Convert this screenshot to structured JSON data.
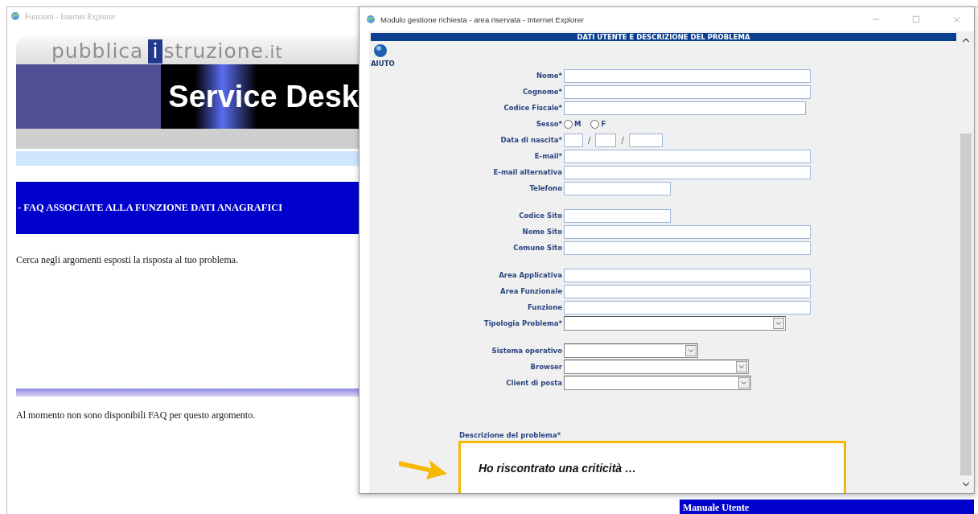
{
  "back_window": {
    "title": "Funzioni - Internet Explorer",
    "logo": {
      "prefix": "pubblica",
      "mark": "i",
      "rest": "struzione",
      "suffix": ".it"
    },
    "banner_title": "Service Desk",
    "faq_heading": "- FAQ ASSOCIATE ALLA FUNZIONE DATI ANAGRAFICI",
    "intro": "Cerca negli argomenti esposti la risposta al tuo problema.",
    "no_faq_message": "Al momento non sono disponibili FAQ per questo argomento.",
    "manual_heading": "Manuale Utente"
  },
  "popup": {
    "title": "Modulo gestione richiesta - area riservata - Internet Explorer",
    "section_title": "DATI UTENTE E DESCRIZIONE DEL PROBLEMA",
    "help_label": "AIUTO",
    "groups": [
      [
        {
          "label": "Nome*",
          "kind": "text"
        },
        {
          "label": "Cognome*",
          "kind": "text"
        },
        {
          "label": "Codice Fiscale*",
          "kind": "text"
        },
        {
          "label": "Sesso*",
          "kind": "radio",
          "options": [
            {
              "label": "M",
              "selected": false
            },
            {
              "label": "F",
              "selected": false
            }
          ]
        },
        {
          "label": "Data di nascita*",
          "kind": "date",
          "separators": [
            "/",
            "/"
          ]
        },
        {
          "label": "E-mail*",
          "kind": "text"
        },
        {
          "label": "E-mail alternativa",
          "kind": "text"
        },
        {
          "label": "Telefono",
          "kind": "text"
        }
      ],
      [
        {
          "label": "Codice Sito",
          "kind": "text"
        },
        {
          "label": "Nome Sito",
          "kind": "text"
        },
        {
          "label": "Comune Sito",
          "kind": "text"
        }
      ],
      [
        {
          "label": "Area Applicativa",
          "kind": "text"
        },
        {
          "label": "Area Funzionale",
          "kind": "text"
        },
        {
          "label": "Funzione",
          "kind": "text"
        },
        {
          "label": "Tipologia Problema*",
          "kind": "select"
        }
      ],
      [
        {
          "label": "Sistema operativo",
          "kind": "select"
        },
        {
          "label": "Browser",
          "kind": "select"
        },
        {
          "label": "Client di posta",
          "kind": "select"
        }
      ]
    ],
    "description": {
      "label": "Descrizione del problema*",
      "value": "Ho riscontrato una criticità …",
      "highlighted": true
    }
  }
}
